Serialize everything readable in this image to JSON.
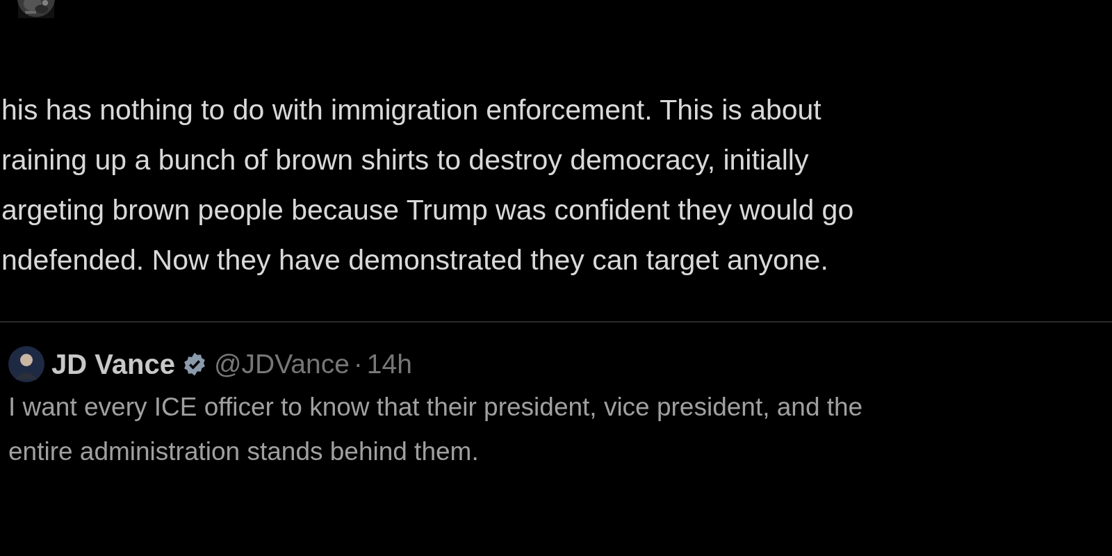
{
  "post": {
    "lines": [
      "his has nothing to do with immigration enforcement. This is about",
      "raining up a bunch of brown shirts to destroy democracy, initially",
      "argeting brown people because Trump was confident they would go",
      "ndefended. Now they have demonstrated they can target anyone."
    ]
  },
  "quoted_post": {
    "name": "JD Vance",
    "verified": true,
    "handle": "@JDVance",
    "separator": "·",
    "time": "14h",
    "lines": [
      "I want every ICE officer to know that their president, vice president, and the",
      "entire administration stands behind them."
    ]
  }
}
